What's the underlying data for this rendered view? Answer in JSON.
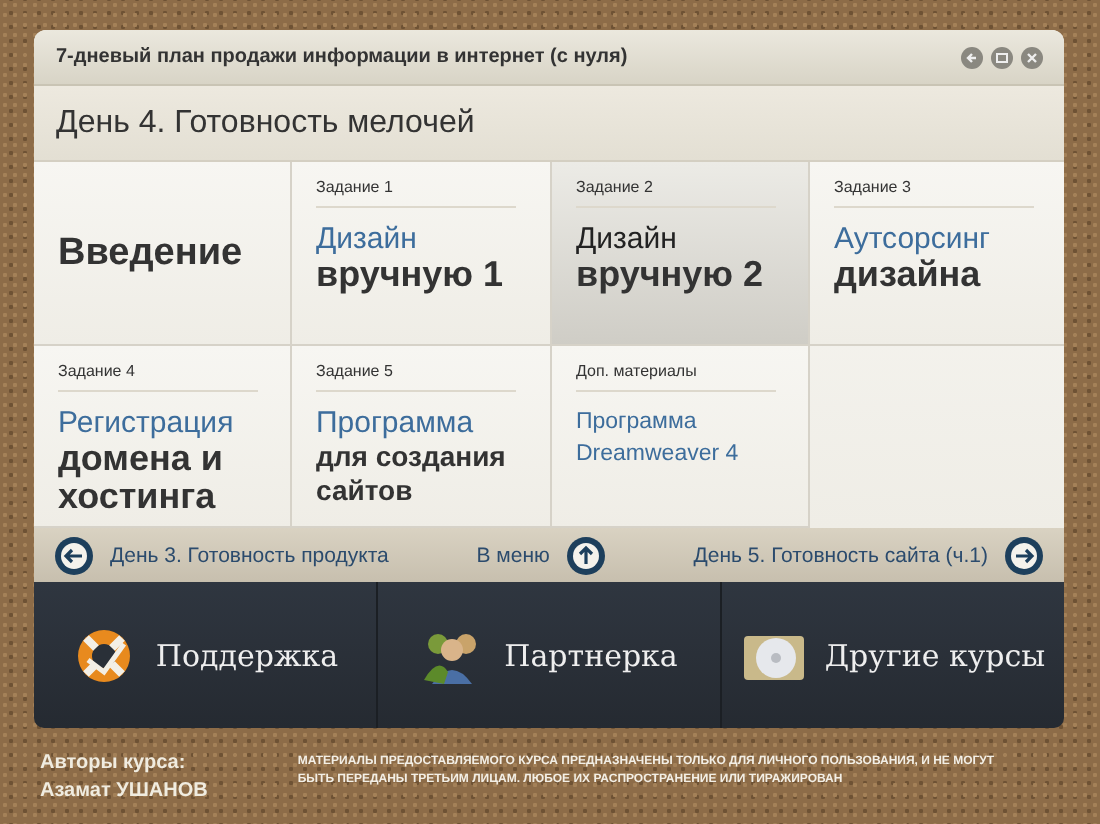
{
  "window": {
    "title": "7-дневый план продажи информации в интернет (с нуля)"
  },
  "heading": "День 4. Готовность мелочей",
  "cells": [
    {
      "selected": false,
      "lines": [
        {
          "text": "Введение",
          "kind": "heading"
        }
      ]
    },
    {
      "label": "Задание 1",
      "selected": false,
      "lines": [
        {
          "text": "Дизайн",
          "kind": "light"
        },
        {
          "text": "вручную 1",
          "kind": "bold"
        }
      ]
    },
    {
      "label": "Задание 2",
      "selected": true,
      "lines": [
        {
          "text": "Дизайн",
          "kind": "light"
        },
        {
          "text": "вручную 2",
          "kind": "bold"
        }
      ]
    },
    {
      "label": "Задание 3",
      "selected": false,
      "lines": [
        {
          "text": "Аутсорсинг",
          "kind": "light"
        },
        {
          "text": "дизайна",
          "kind": "bold"
        }
      ]
    },
    {
      "label": "Задание 4",
      "selected": false,
      "lines": [
        {
          "text": "Регистрация",
          "kind": "light"
        },
        {
          "text": "домена и",
          "kind": "bold"
        },
        {
          "text": "хостинга",
          "kind": "bold"
        }
      ]
    },
    {
      "label": "Задание 5",
      "selected": false,
      "lines": [
        {
          "text": "Программа",
          "kind": "light"
        },
        {
          "text": "для создания",
          "kind": "bold-small"
        },
        {
          "text": "сайтов",
          "kind": "bold-small"
        }
      ]
    },
    {
      "label": "Доп. материалы",
      "selected": false,
      "lines": [
        {
          "text": "Программа",
          "kind": "small"
        },
        {
          "text": "Dreamweaver 4",
          "kind": "small"
        }
      ]
    }
  ],
  "nav": {
    "prev": "День 3. Готовность продукта",
    "menu": "В меню",
    "next": "День 5. Готовность сайта (ч.1)"
  },
  "bottom_links": [
    {
      "label": "Поддержка"
    },
    {
      "label": "Партнерка"
    },
    {
      "label": "Другие курсы"
    }
  ],
  "footer": {
    "authors_label": "Авторы курса:",
    "author": "Азамат УШАНОВ",
    "notice": [
      "МАТЕРИАЛЫ ПРЕДОСТАВЛЯЕМОГО КУРСА ПРЕДНАЗНАЧЕНЫ ТОЛЬКО ДЛЯ ЛИЧНОГО ПОЛЬЗОВАНИЯ, И НЕ МОГУТ",
      "БЫТЬ ПЕРЕДАНЫ ТРЕТЬИМ ЛИЦАМ. ЛЮБОЕ ИХ РАСПРОСТРАНЕНИЕ ИЛИ ТИРАЖИРОВАН"
    ]
  }
}
